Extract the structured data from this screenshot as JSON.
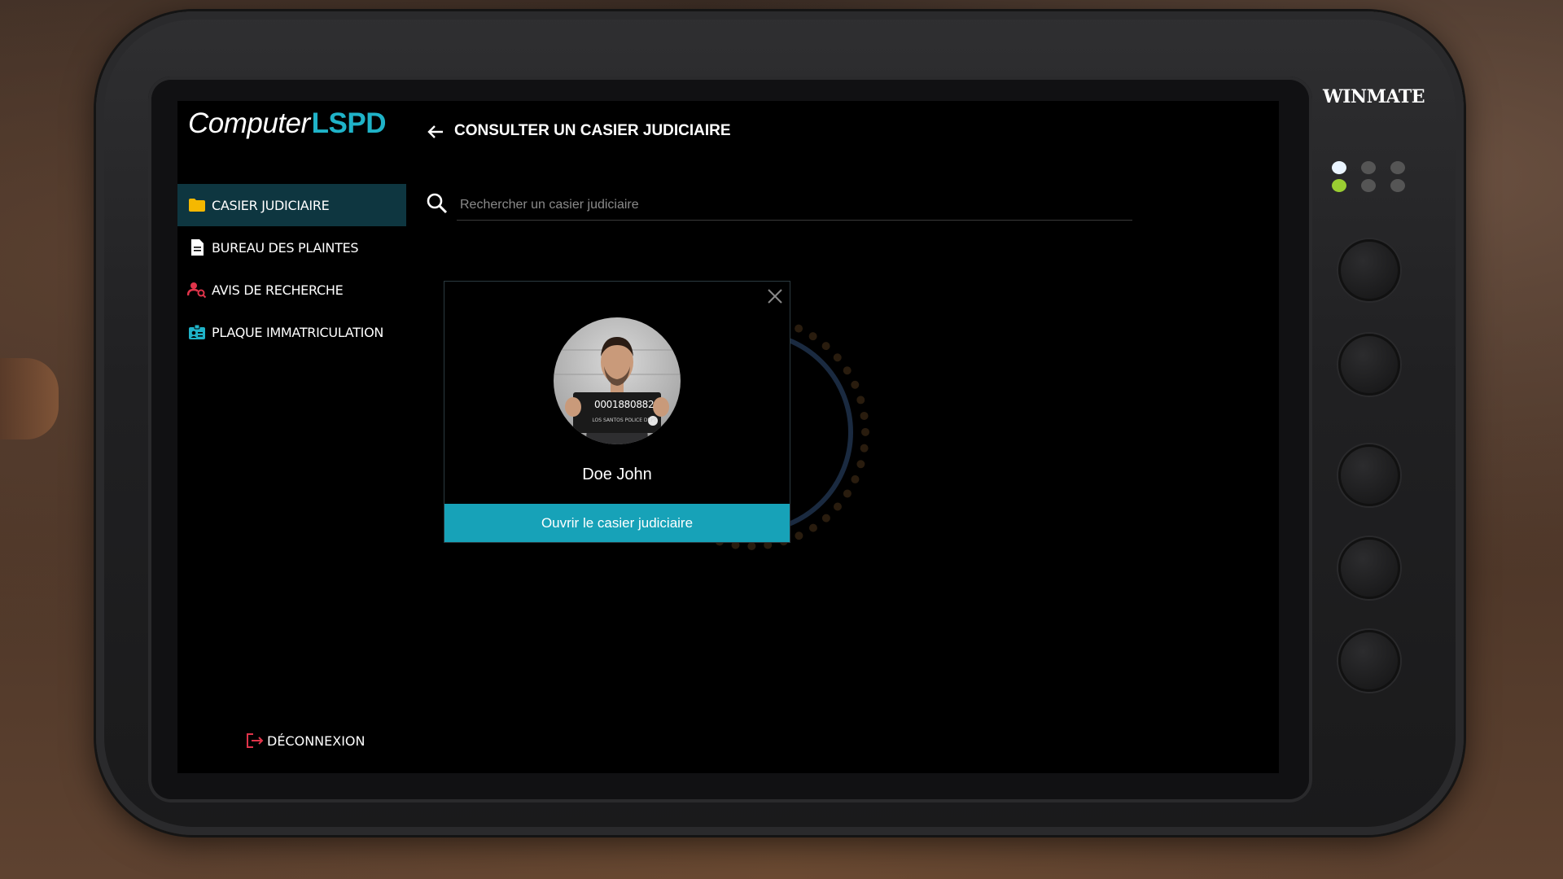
{
  "app": {
    "logo_main": "Computer",
    "logo_accent": "LSPD"
  },
  "sidebar": {
    "items": [
      {
        "label": "CASIER JUDICIAIRE",
        "icon": "folder-icon",
        "color": "#f5b800",
        "active": true
      },
      {
        "label": "BUREAU DES PLAINTES",
        "icon": "document-icon",
        "color": "#ffffff",
        "active": false
      },
      {
        "label": "AVIS DE RECHERCHE",
        "icon": "user-search-icon",
        "color": "#e0344a",
        "active": false
      },
      {
        "label": "PLAQUE IMMATRICULATION",
        "icon": "id-card-icon",
        "color": "#1fb3c8",
        "active": false
      }
    ],
    "logout_label": "DÉCONNEXION",
    "logout_color": "#e0344a"
  },
  "header": {
    "title": "CONSULTER UN CASIER JUDICIAIRE"
  },
  "search": {
    "placeholder": "Rechercher un casier judiciaire"
  },
  "card": {
    "name": "Doe John",
    "mugshot_number": "0001880882",
    "mugshot_caption": "LOS SANTOS POLICE DEPT",
    "button_label": "Ouvrir le casier judiciaire"
  },
  "device": {
    "brand": "WINMATE"
  },
  "colors": {
    "accent": "#17a2b8",
    "active_bg": "#0e3640"
  }
}
